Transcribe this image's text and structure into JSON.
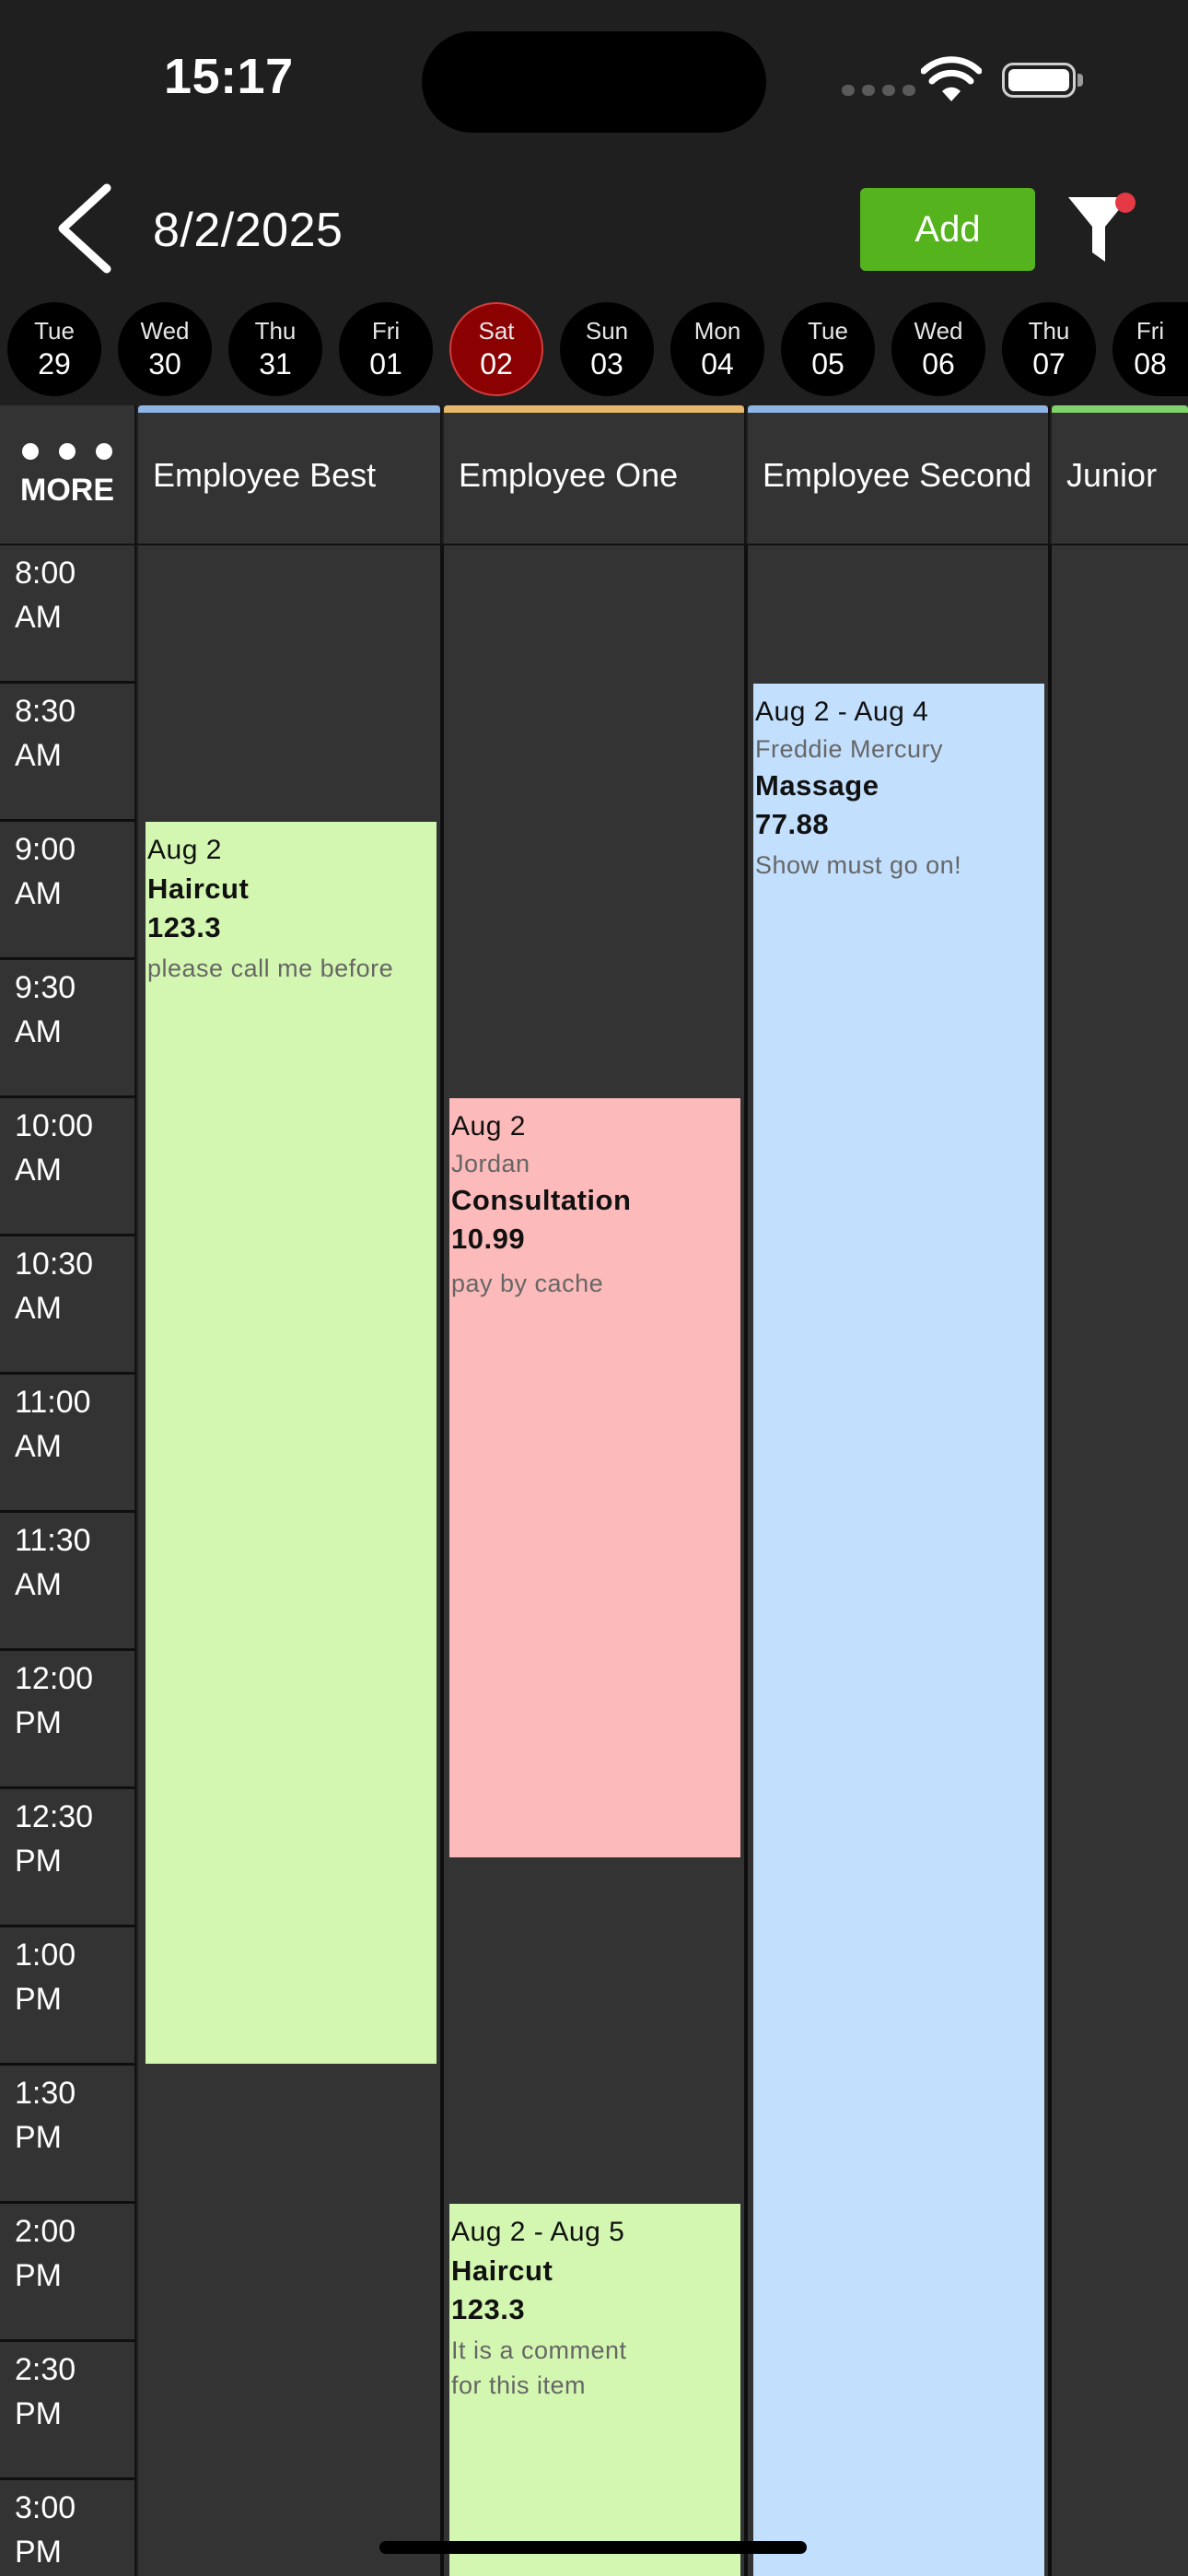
{
  "status_bar": {
    "time": "15:17"
  },
  "header": {
    "date": "8/2/2025",
    "add_label": "Add",
    "colors": {
      "add_button": "#55b41d",
      "filter_badge": "#e53945"
    }
  },
  "days": [
    {
      "name": "Tue",
      "num": "29",
      "selected": false
    },
    {
      "name": "Wed",
      "num": "30",
      "selected": false
    },
    {
      "name": "Thu",
      "num": "31",
      "selected": false
    },
    {
      "name": "Fri",
      "num": "01",
      "selected": false
    },
    {
      "name": "Sat",
      "num": "02",
      "selected": true
    },
    {
      "name": "Sun",
      "num": "03",
      "selected": false
    },
    {
      "name": "Mon",
      "num": "04",
      "selected": false
    },
    {
      "name": "Tue",
      "num": "05",
      "selected": false
    },
    {
      "name": "Wed",
      "num": "06",
      "selected": false
    },
    {
      "name": "Thu",
      "num": "07",
      "selected": false
    },
    {
      "name": "Fri",
      "num": "08",
      "selected": false
    }
  ],
  "more_label": "MORE",
  "employees": [
    {
      "name": "Employee Best",
      "color": "#8fb4e6"
    },
    {
      "name": "Employee One",
      "color": "#e8b86a"
    },
    {
      "name": "Employee Second",
      "color": "#8fb4e6"
    },
    {
      "name": "Junior",
      "color": "#7fd36a"
    }
  ],
  "time_slots": [
    [
      "8:00",
      "AM"
    ],
    [
      "8:30",
      "AM"
    ],
    [
      "9:00",
      "AM"
    ],
    [
      "9:30",
      "AM"
    ],
    [
      "10:00",
      "AM"
    ],
    [
      "10:30",
      "AM"
    ],
    [
      "11:00",
      "AM"
    ],
    [
      "11:30",
      "AM"
    ],
    [
      "12:00",
      "PM"
    ],
    [
      "12:30",
      "PM"
    ],
    [
      "1:00",
      "PM"
    ],
    [
      "1:30",
      "PM"
    ],
    [
      "2:00",
      "PM"
    ],
    [
      "2:30",
      "PM"
    ],
    [
      "3:00",
      "PM"
    ]
  ],
  "events": {
    "best_haircut": {
      "date": "Aug 2",
      "service": "Haircut",
      "price": "123.3",
      "comment": "please call me before",
      "color": "#d3f7b0"
    },
    "one_consultation": {
      "date": "Aug 2",
      "client": "Jordan",
      "service": "Consultation",
      "price": "10.99",
      "comment": "pay by cache",
      "color": "#fcbaba"
    },
    "one_haircut": {
      "date": "Aug 2 - Aug 5",
      "service": "Haircut",
      "price": "123.3",
      "comment_line1": "It is a comment",
      "comment_line2": "for this item",
      "color": "#d3f7b0"
    },
    "second_massage": {
      "date": "Aug 2 - Aug 4",
      "client": "Freddie Mercury",
      "service": "Massage",
      "price": "77.88",
      "comment": "Show must go on!",
      "color": "#c2dffd"
    }
  }
}
